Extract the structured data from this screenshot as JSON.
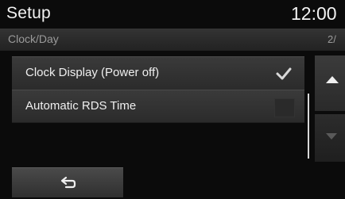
{
  "header": {
    "title": "Setup",
    "clock": "12:00"
  },
  "subheader": {
    "title": "Clock/Day",
    "page_indicator": "2/"
  },
  "list": {
    "items": [
      {
        "label": "Clock Display (Power off)",
        "checked": true
      },
      {
        "label": "Automatic RDS Time",
        "checked": false
      }
    ]
  },
  "nav": {
    "up_icon": "arrow-up-icon",
    "down_icon": "arrow-down-icon"
  },
  "footer": {
    "back_icon": "back-arrow-icon"
  }
}
